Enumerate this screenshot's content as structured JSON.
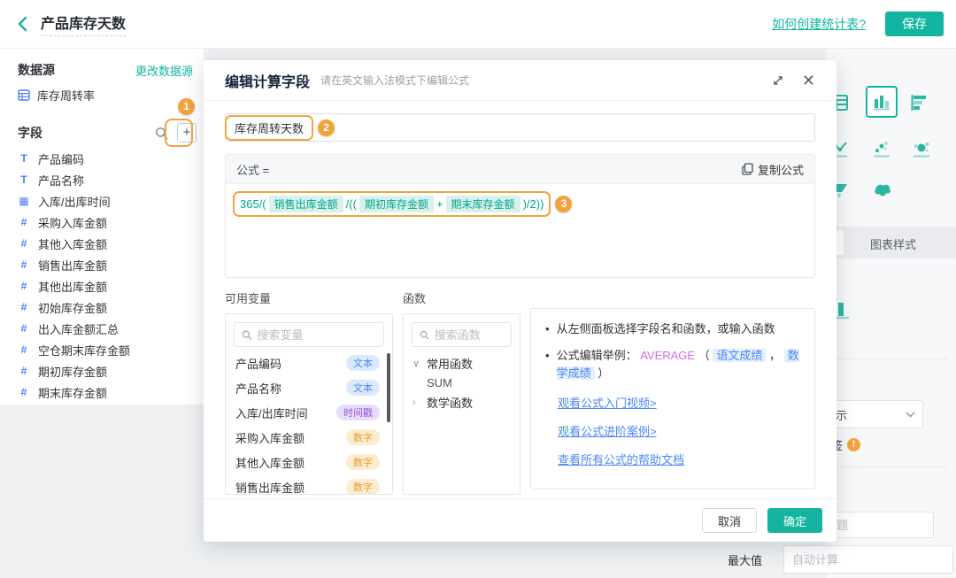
{
  "topbar": {
    "title": "产品库存天数",
    "help_link": "如何创建统计表?",
    "save": "保存"
  },
  "sidebar": {
    "datasource_label": "数据源",
    "change_datasource": "更改数据源",
    "datasource_name": "库存周转率",
    "fields_label": "字段",
    "add_label": "+",
    "fields": [
      {
        "name": "产品编码",
        "kind": "text"
      },
      {
        "name": "产品名称",
        "kind": "text"
      },
      {
        "name": "入库/出库时间",
        "kind": "date"
      },
      {
        "name": "采购入库金额",
        "kind": "number"
      },
      {
        "name": "其他入库金额",
        "kind": "number"
      },
      {
        "name": "销售出库金额",
        "kind": "number"
      },
      {
        "name": "其他出库金额",
        "kind": "number"
      },
      {
        "name": "初始库存金额",
        "kind": "number"
      },
      {
        "name": "出入库金额汇总",
        "kind": "number"
      },
      {
        "name": "空仓期末库存金额",
        "kind": "number"
      },
      {
        "name": "期初库存金额",
        "kind": "number"
      },
      {
        "name": "期末库存金额",
        "kind": "number"
      }
    ]
  },
  "annotations": {
    "step1": "1",
    "step2": "2",
    "step3": "3"
  },
  "modal": {
    "title": "编辑计算字段",
    "subtitle": "请在英文输入法模式下编辑公式",
    "field_name": "库存周转天数",
    "formula_label": "公式 =",
    "copy_formula": "复制公式",
    "formula_tokens": [
      {
        "t": "text",
        "v": "365/("
      },
      {
        "t": "chip",
        "v": "销售出库金额"
      },
      {
        "t": "text",
        "v": "/(("
      },
      {
        "t": "chip",
        "v": "期初库存金额"
      },
      {
        "t": "text",
        "v": "+"
      },
      {
        "t": "chip",
        "v": "期末库存金额"
      },
      {
        "t": "text",
        "v": ")/2))"
      }
    ],
    "variables": {
      "label": "可用变量",
      "search_placeholder": "搜索变量",
      "items": [
        {
          "name": "产品编码",
          "tag": "文本",
          "kind": "text"
        },
        {
          "name": "产品名称",
          "tag": "文本",
          "kind": "text"
        },
        {
          "name": "入库/出库时间",
          "tag": "时间戳",
          "kind": "datetime"
        },
        {
          "name": "采购入库金额",
          "tag": "数字",
          "kind": "number"
        },
        {
          "name": "其他入库金额",
          "tag": "数字",
          "kind": "number"
        },
        {
          "name": "销售出库金额",
          "tag": "数字",
          "kind": "number"
        }
      ]
    },
    "functions": {
      "label": "函数",
      "search_placeholder": "搜索函数",
      "groups": [
        {
          "label": "常用函数",
          "expanded": true,
          "items": [
            "SUM"
          ]
        },
        {
          "label": "数学函数",
          "expanded": false,
          "items": []
        }
      ]
    },
    "help": {
      "tip1": "从左侧面板选择字段名和函数，或输入函数",
      "tip2_prefix": "公式编辑举例：",
      "tip2_func": "AVERAGE",
      "tip2_open": "（",
      "tip2_chip1": "语文成绩",
      "tip2_comma": "，",
      "tip2_chip2": "数学成绩",
      "tip2_close": "）",
      "links": [
        "观看公式入门视频>",
        "观看公式进阶案例>",
        "查看所有公式的帮助文档"
      ]
    },
    "cancel": "取消",
    "ok": "确定"
  },
  "right_panel": {
    "chart_type_icons": [
      "table-chart",
      "bar-chart",
      "horizontal-bar-chart",
      "line-chart",
      "scatter-chart",
      "bubble-chart",
      "funnel-chart",
      "map-chart"
    ],
    "selected_chart_type": "bar-chart",
    "style_tab": "图表样式",
    "select_value_partial": "示",
    "warning_label": "签",
    "title_placeholder_partial": "题",
    "max_label": "最大值",
    "max_placeholder": "自动计算"
  },
  "colors": {
    "accent_teal": "#13b5a0",
    "annotation_orange": "#f3a33d",
    "field_icon_blue": "#4f7df9",
    "link_blue": "#4b87f5",
    "func_magenta": "#d269e8",
    "chip_green_bg": "#d8f1e9"
  }
}
